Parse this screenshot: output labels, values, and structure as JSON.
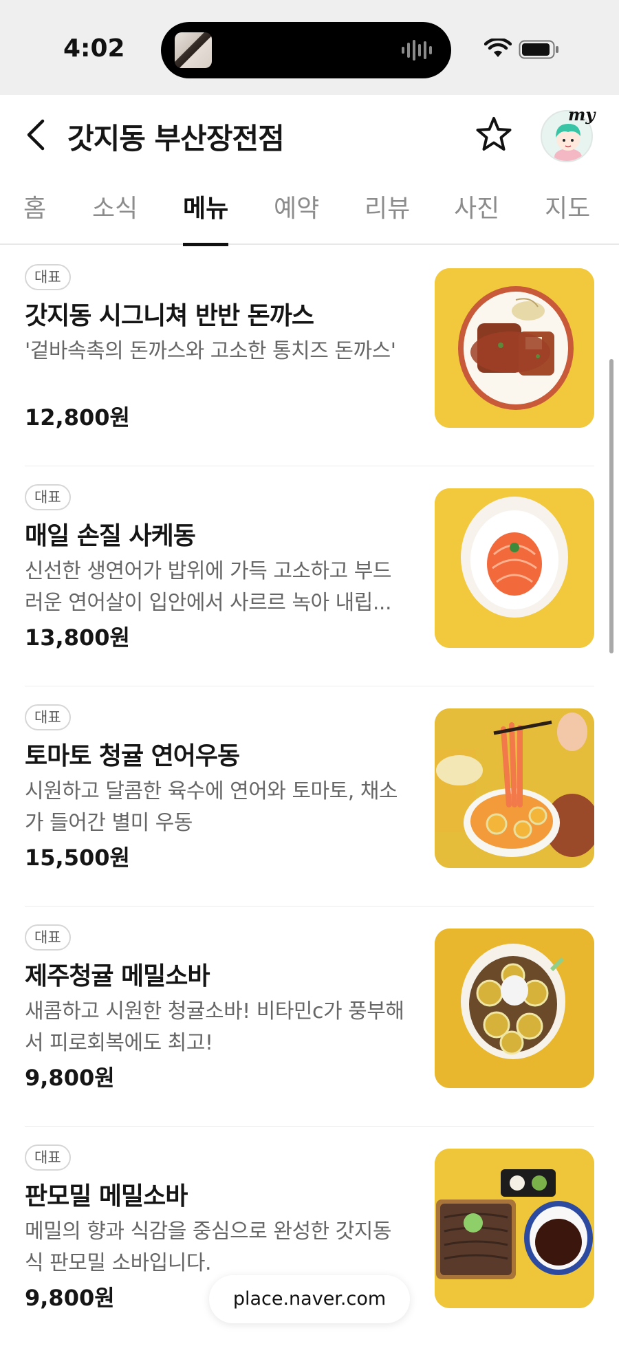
{
  "status_bar": {
    "time": "4:02"
  },
  "header": {
    "title": "갓지동 부산장전점",
    "avatar_label": "my"
  },
  "tabs": [
    {
      "label": "홈",
      "active": false
    },
    {
      "label": "소식",
      "active": false
    },
    {
      "label": "메뉴",
      "active": true
    },
    {
      "label": "예약",
      "active": false
    },
    {
      "label": "리뷰",
      "active": false
    },
    {
      "label": "사진",
      "active": false
    },
    {
      "label": "지도",
      "active": false
    }
  ],
  "menu_items": [
    {
      "badge": "대표",
      "name": "갓지동 시그니쳐 반반 돈까스",
      "description": "'겉바속촉의 돈까스와 고소한 통치즈 돈까스'",
      "price": "12,800원"
    },
    {
      "badge": "대표",
      "name": "매일 손질 사케동",
      "description": "신선한 생연어가 밥위에 가득 고소하고 부드러운 연어살이 입안에서 사르르 녹아 내립...",
      "price": "13,800원"
    },
    {
      "badge": "대표",
      "name": "토마토 청귤 연어우동",
      "description": "시원하고 달콤한 육수에 연어와 토마토, 채소가 들어간 별미 우동",
      "price": "15,500원"
    },
    {
      "badge": "대표",
      "name": "제주청귤 메밀소바",
      "description": "새콤하고 시원한 청귤소바! 비타민c가 풍부해서 피로회복에도 최고!",
      "price": "9,800원"
    },
    {
      "badge": "대표",
      "name": "판모밀 메밀소바",
      "description": "메밀의 향과 식감을 중심으로 완성한 갓지동식 판모밀 소바입니다.",
      "price": "9,800원"
    }
  ],
  "url_bar": {
    "domain": "place.naver.com"
  },
  "colors": {
    "status_bg": "#efefef",
    "image_bg": "#f1c93a",
    "active_tab": "#111111",
    "inactive_tab": "#8c8c8c"
  }
}
